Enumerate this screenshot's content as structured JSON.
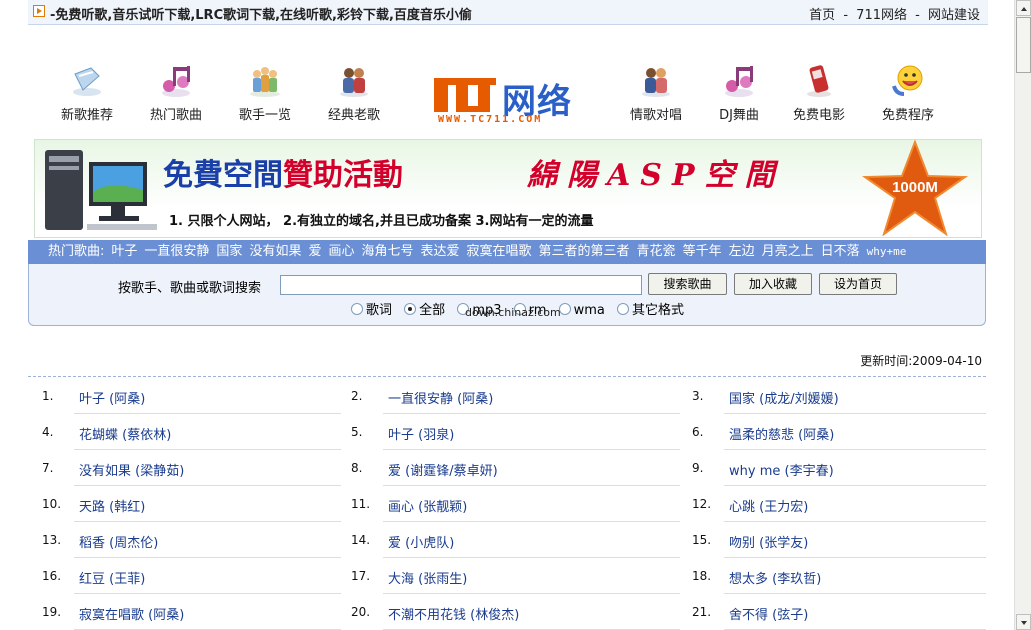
{
  "header": {
    "title": "-免费听歌,音乐试听下载,LRC歌词下载,在线听歌,彩铃下载,百度音乐小偷",
    "links": [
      "首页",
      "711网络",
      "网站建设"
    ],
    "sep": "-"
  },
  "nav": [
    {
      "label": "新歌推荐",
      "icon": "new-songs-icon"
    },
    {
      "label": "热门歌曲",
      "icon": "hot-songs-icon"
    },
    {
      "label": "歌手一览",
      "icon": "singers-icon"
    },
    {
      "label": "经典老歌",
      "icon": "classic-songs-icon"
    },
    {
      "label": "情歌对唱",
      "icon": "duet-icon"
    },
    {
      "label": "DJ舞曲",
      "icon": "dj-music-icon"
    },
    {
      "label": "免费电影",
      "icon": "movie-phone-icon"
    },
    {
      "label": "免费程序",
      "icon": "programs-smiley-icon"
    }
  ],
  "logo": {
    "text": "网络",
    "url": "WWW.TC711.COM"
  },
  "banner": {
    "headline_a": "免費空間",
    "headline_b": "贊助活動",
    "headline_c": "綿陽ASP空間",
    "sub": "1. 只限个人网站，  2.有独立的域名,并且已成功备案   3.网站有一定的流量",
    "badge": "1000M"
  },
  "hot": {
    "label": "热门歌曲:",
    "items": [
      "叶子",
      "一直很安静",
      "国家",
      "没有如果",
      "爱",
      "画心",
      "海角七号",
      "表达爱",
      "寂寞在唱歌",
      "第三者的第三者",
      "青花瓷",
      "等千年",
      "左边",
      "月亮之上",
      "日不落",
      "why+me"
    ]
  },
  "search": {
    "label": "按歌手、歌曲或歌词搜索",
    "value": "",
    "btn_search": "搜索歌曲",
    "btn_fav": "加入收藏",
    "btn_home": "设为首页",
    "options": [
      "歌词",
      "全部",
      "mp3",
      "rm",
      "wma",
      "其它格式"
    ],
    "selected": "全部",
    "watermark": "down.chinaz.com"
  },
  "updated": "更新时间:2009-04-10",
  "songs": [
    {
      "n": "1.",
      "t": "叶子 (阿桑)"
    },
    {
      "n": "2.",
      "t": "一直很安静 (阿桑)"
    },
    {
      "n": "3.",
      "t": "国家 (成龙/刘媛媛)"
    },
    {
      "n": "4.",
      "t": "花蝴蝶 (蔡依林)"
    },
    {
      "n": "5.",
      "t": "叶子 (羽泉)"
    },
    {
      "n": "6.",
      "t": "温柔的慈悲 (阿桑)"
    },
    {
      "n": "7.",
      "t": "没有如果 (梁静茹)"
    },
    {
      "n": "8.",
      "t": "爱 (谢霆锋/蔡卓妍)"
    },
    {
      "n": "9.",
      "t": "why me (李宇春)"
    },
    {
      "n": "10.",
      "t": "天路 (韩红)"
    },
    {
      "n": "11.",
      "t": "画心 (张靓颖)"
    },
    {
      "n": "12.",
      "t": "心跳 (王力宏)"
    },
    {
      "n": "13.",
      "t": "稻香 (周杰伦)"
    },
    {
      "n": "14.",
      "t": "爱 (小虎队)"
    },
    {
      "n": "15.",
      "t": "吻别 (张学友)"
    },
    {
      "n": "16.",
      "t": "红豆 (王菲)"
    },
    {
      "n": "17.",
      "t": "大海 (张雨生)"
    },
    {
      "n": "18.",
      "t": "想太多 (李玖哲)"
    },
    {
      "n": "19.",
      "t": "寂寞在唱歌 (阿桑)"
    },
    {
      "n": "20.",
      "t": "不潮不用花钱 (林俊杰)"
    },
    {
      "n": "21.",
      "t": "舍不得 (弦子)"
    }
  ],
  "colors": {
    "link": "#1a3c8e",
    "hotbar": "#6b8fd4",
    "accent": "#e65a00",
    "brand_blue": "#2a5fc8"
  }
}
